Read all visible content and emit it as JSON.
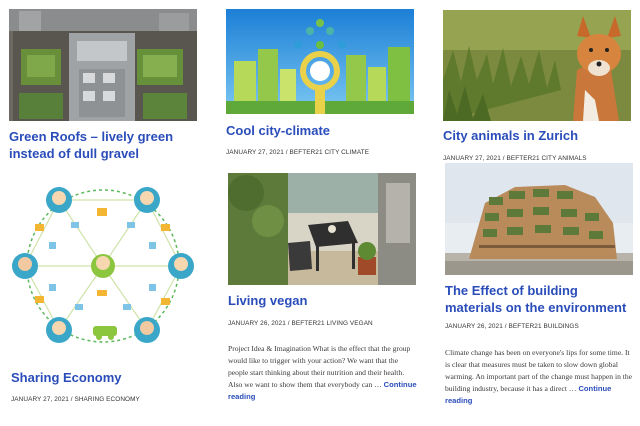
{
  "posts": [
    {
      "title": "Green Roofs – lively green instead of dull gravel",
      "meta": "",
      "excerpt": "",
      "more": ""
    },
    {
      "title": "Cool city-climate",
      "meta": "JANUARY 27, 2021 / BEFTER21 CITY CLIMATE",
      "excerpt": "",
      "more": ""
    },
    {
      "title": "City animals in Zurich",
      "meta": "JANUARY 27, 2021 / BEFTER21 CITY ANIMALS",
      "excerpt": "",
      "more": ""
    },
    {
      "title": "Sharing Economy",
      "meta": "JANUARY 27, 2021 / SHARING ECONOMY",
      "excerpt": "",
      "more": ""
    },
    {
      "title": "Living vegan",
      "meta": "JANUARY 26, 2021 / BEFTER21 LIVING VEGAN",
      "excerpt": "Project Idea & Imagination What is the effect that the group would like to trigger with your action? We want that the people start thinking about their nutrition and their health. Also we want to show them that everybody can …",
      "more": "Continue reading"
    },
    {
      "title": "The Effect of building materials on the environment",
      "meta": "JANUARY 26, 2021 / BEFTER21 BUILDINGS",
      "excerpt": "Climate change has been on everyone's lips for some time. It is clear that measures must be taken to slow down global warming. An important part of the change must happen in the building industry, because it has a direct …",
      "more": "Continue reading"
    }
  ],
  "colors": {
    "link": "#2a4dba",
    "meta": "#333333",
    "body_text": "#3a3a3a"
  },
  "icons": {
    "post1": "green-roof-photo",
    "post2": "city-climate-illustration",
    "post3": "fox-photo",
    "post4": "sharing-economy-network",
    "post5": "vegan-balcony-photo",
    "post6": "green-building-photo"
  }
}
